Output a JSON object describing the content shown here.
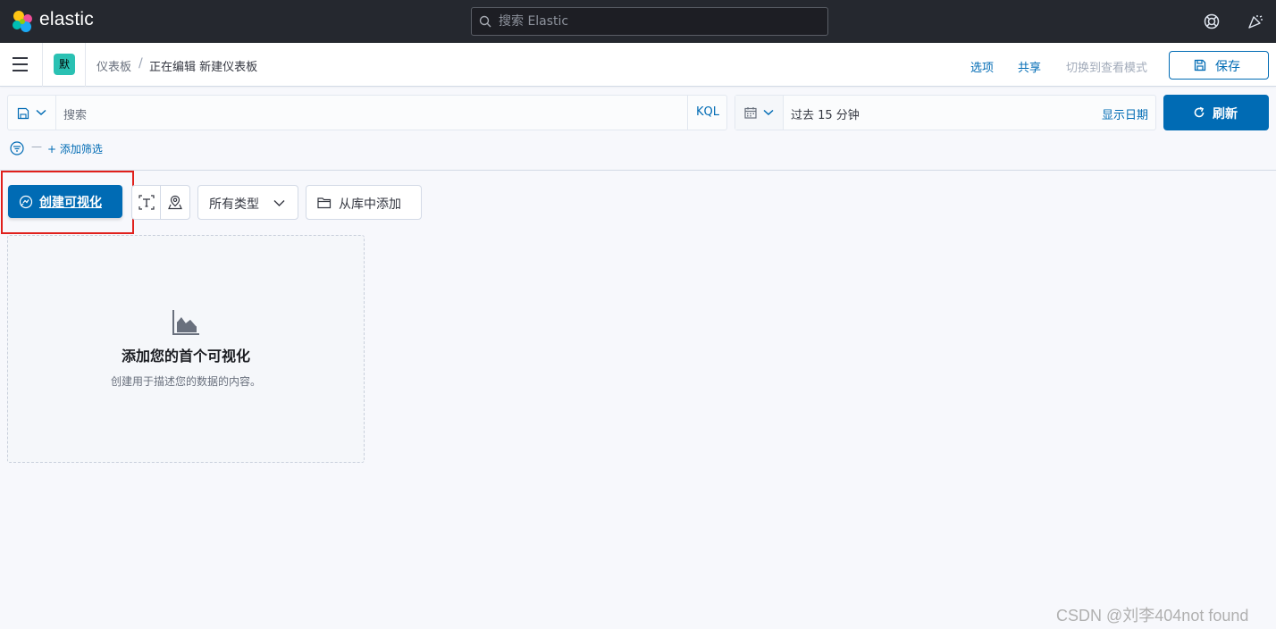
{
  "header": {
    "logo_text": "elastic",
    "search_placeholder": "搜索 Elastic"
  },
  "app_header": {
    "space_avatar": "默",
    "breadcrumb_root": "仪表板",
    "breadcrumb_sep": "/",
    "breadcrumb_current": "正在编辑 新建仪表板",
    "options_label": "选项",
    "share_label": "共享",
    "view_mode_label": "切换到查看模式",
    "save_label": "保存"
  },
  "query_bar": {
    "placeholder": "搜索",
    "language": "KQL"
  },
  "date_picker": {
    "range": "过去 15 分钟",
    "show_dates": "显示日期"
  },
  "refresh_label": "刷新",
  "filter": {
    "dash": "—",
    "add_label": "+ 添加筛选"
  },
  "toolbar": {
    "create_label": "创建可视化",
    "types_label": "所有类型",
    "library_label": "从库中添加"
  },
  "empty_state": {
    "title": "添加您的首个可视化",
    "description": "创建用于描述您的数据的内容。"
  },
  "watermark": "CSDN @刘李404not found",
  "colors": {
    "primary": "#006bb4",
    "header_bg": "#25282f",
    "highlight": "#e0201c"
  }
}
